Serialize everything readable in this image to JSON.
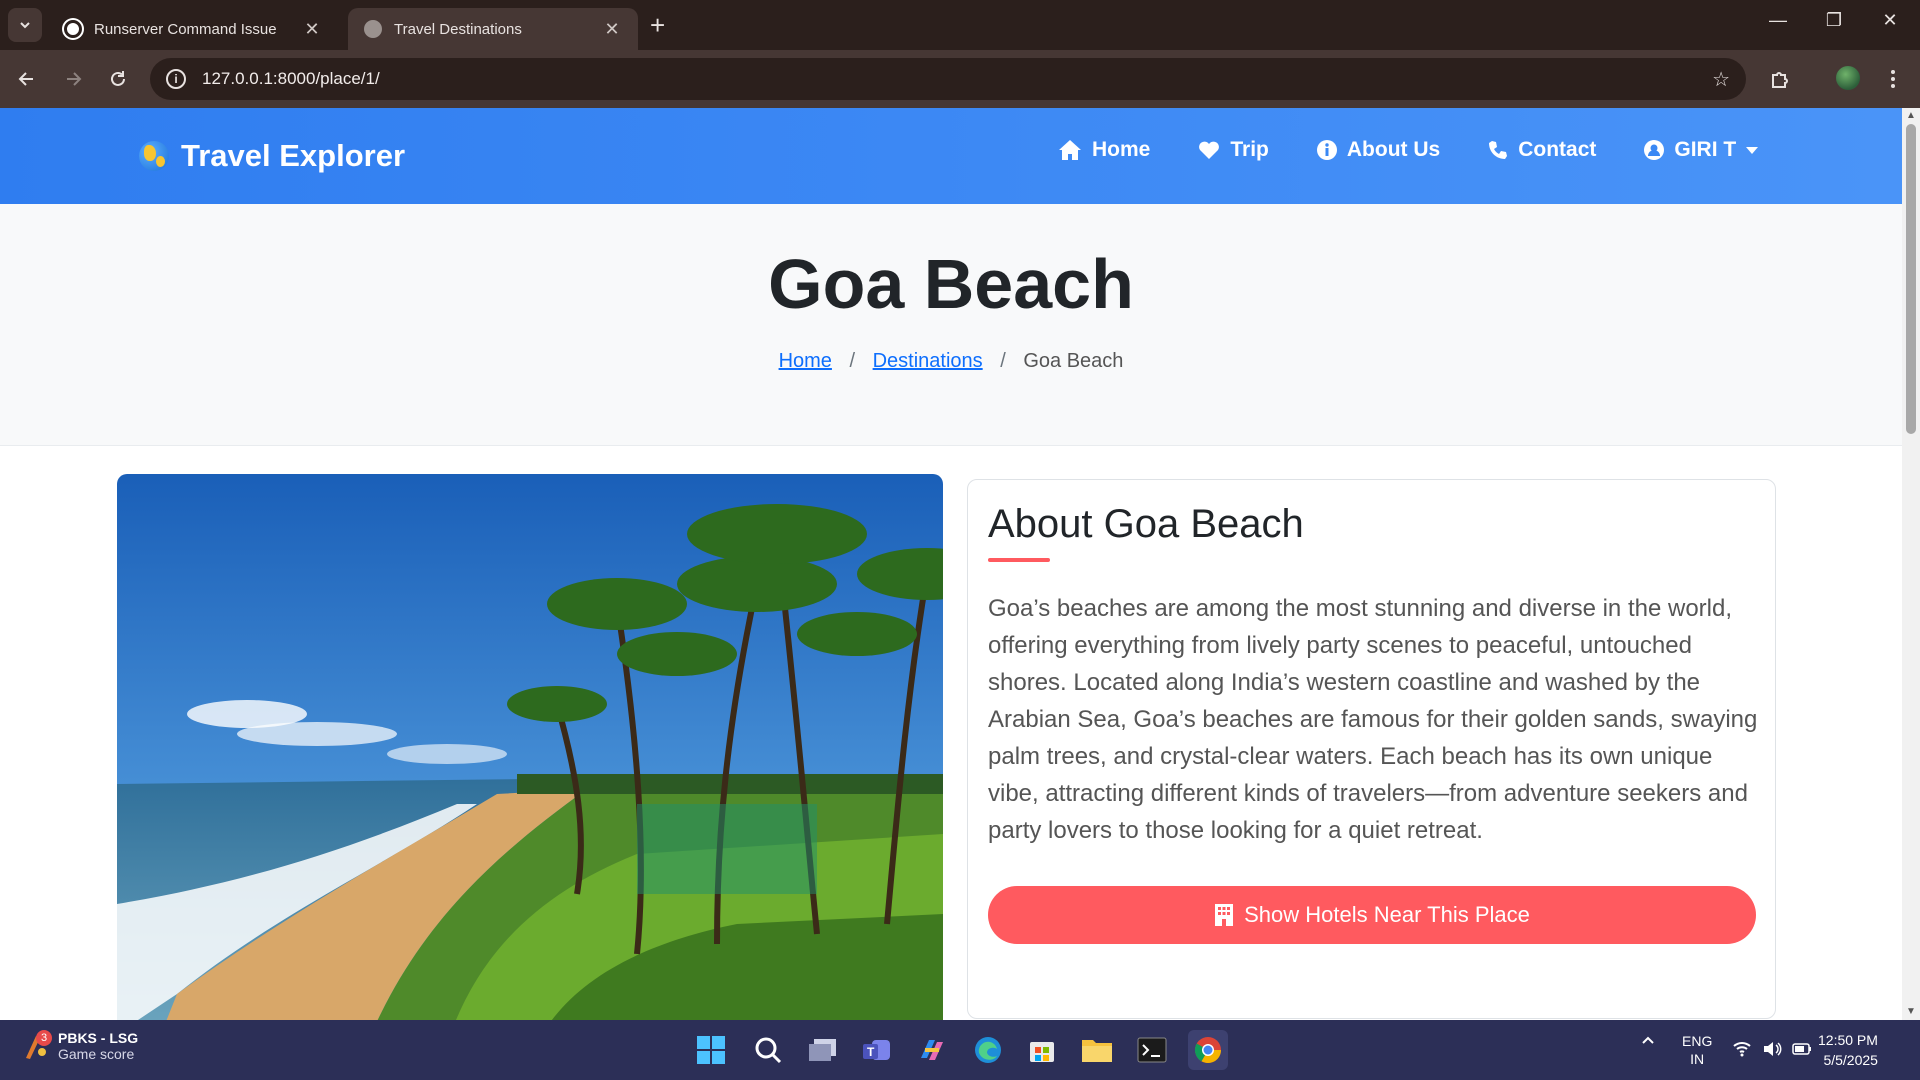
{
  "browser": {
    "tabs": [
      {
        "title": "Runserver Command Issue",
        "active": false
      },
      {
        "title": "Travel Destinations",
        "active": true
      }
    ],
    "url": "127.0.0.1:8000/place/1/"
  },
  "navbar": {
    "brand": "Travel Explorer",
    "links": [
      "Home",
      "Trip",
      "About Us",
      "Contact"
    ],
    "user": "GIRI T"
  },
  "hero": {
    "title": "Goa Beach",
    "breadcrumb": [
      "Home",
      "Destinations",
      "Goa Beach"
    ],
    "breadcrumb_sep": "/"
  },
  "about": {
    "heading": "About Goa Beach",
    "description": "Goa’s beaches are among the most stunning and diverse in the world, offering everything from lively party scenes to peaceful, untouched shores. Located along India’s western coastline and washed by the Arabian Sea, Goa’s beaches are famous for their golden sands, swaying palm trees, and crystal-clear waters. Each beach has its own unique vibe, attracting different kinds of travelers—from adventure seekers and party lovers to those looking for a quiet retreat.",
    "button": "Show Hotels Near This Place"
  },
  "taskbar": {
    "widget_badge": "3",
    "widget_title": "PBKS - LSG",
    "widget_subtitle": "Game score",
    "lang_top": "ENG",
    "lang_bottom": "IN",
    "time": "12:50 PM",
    "date": "5/5/2025"
  },
  "colors": {
    "navbar": "#2f7df0",
    "accent": "#ff5a5f",
    "link": "#0d6efd"
  }
}
